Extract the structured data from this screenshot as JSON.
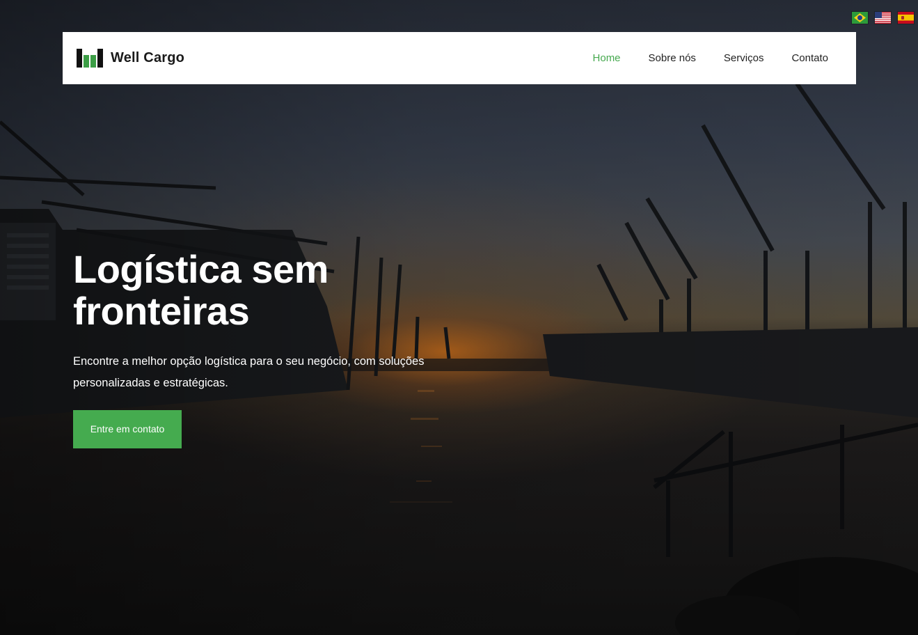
{
  "brand": {
    "name": "Well Cargo",
    "logo_icon": "bar-logo-icon",
    "accent_color": "#45ab4f"
  },
  "languages": [
    {
      "code": "pt-BR",
      "icon": "flag-brazil-icon"
    },
    {
      "code": "en-US",
      "icon": "flag-usa-icon"
    },
    {
      "code": "es",
      "icon": "flag-spain-icon"
    }
  ],
  "nav": {
    "items": [
      {
        "label": "Home",
        "active": true
      },
      {
        "label": "Sobre nós",
        "active": false
      },
      {
        "label": "Serviços",
        "active": false
      },
      {
        "label": "Contato",
        "active": false
      }
    ]
  },
  "hero": {
    "title_line1": "Logística sem",
    "title_line2": "fronteiras",
    "text_line1": "Encontre a melhor opção logística para o seu negócio, com soluções",
    "text_line2": "personalizadas e estratégicas.",
    "cta_label": "Entre em contato",
    "background": "harbour-sunset-photo"
  }
}
